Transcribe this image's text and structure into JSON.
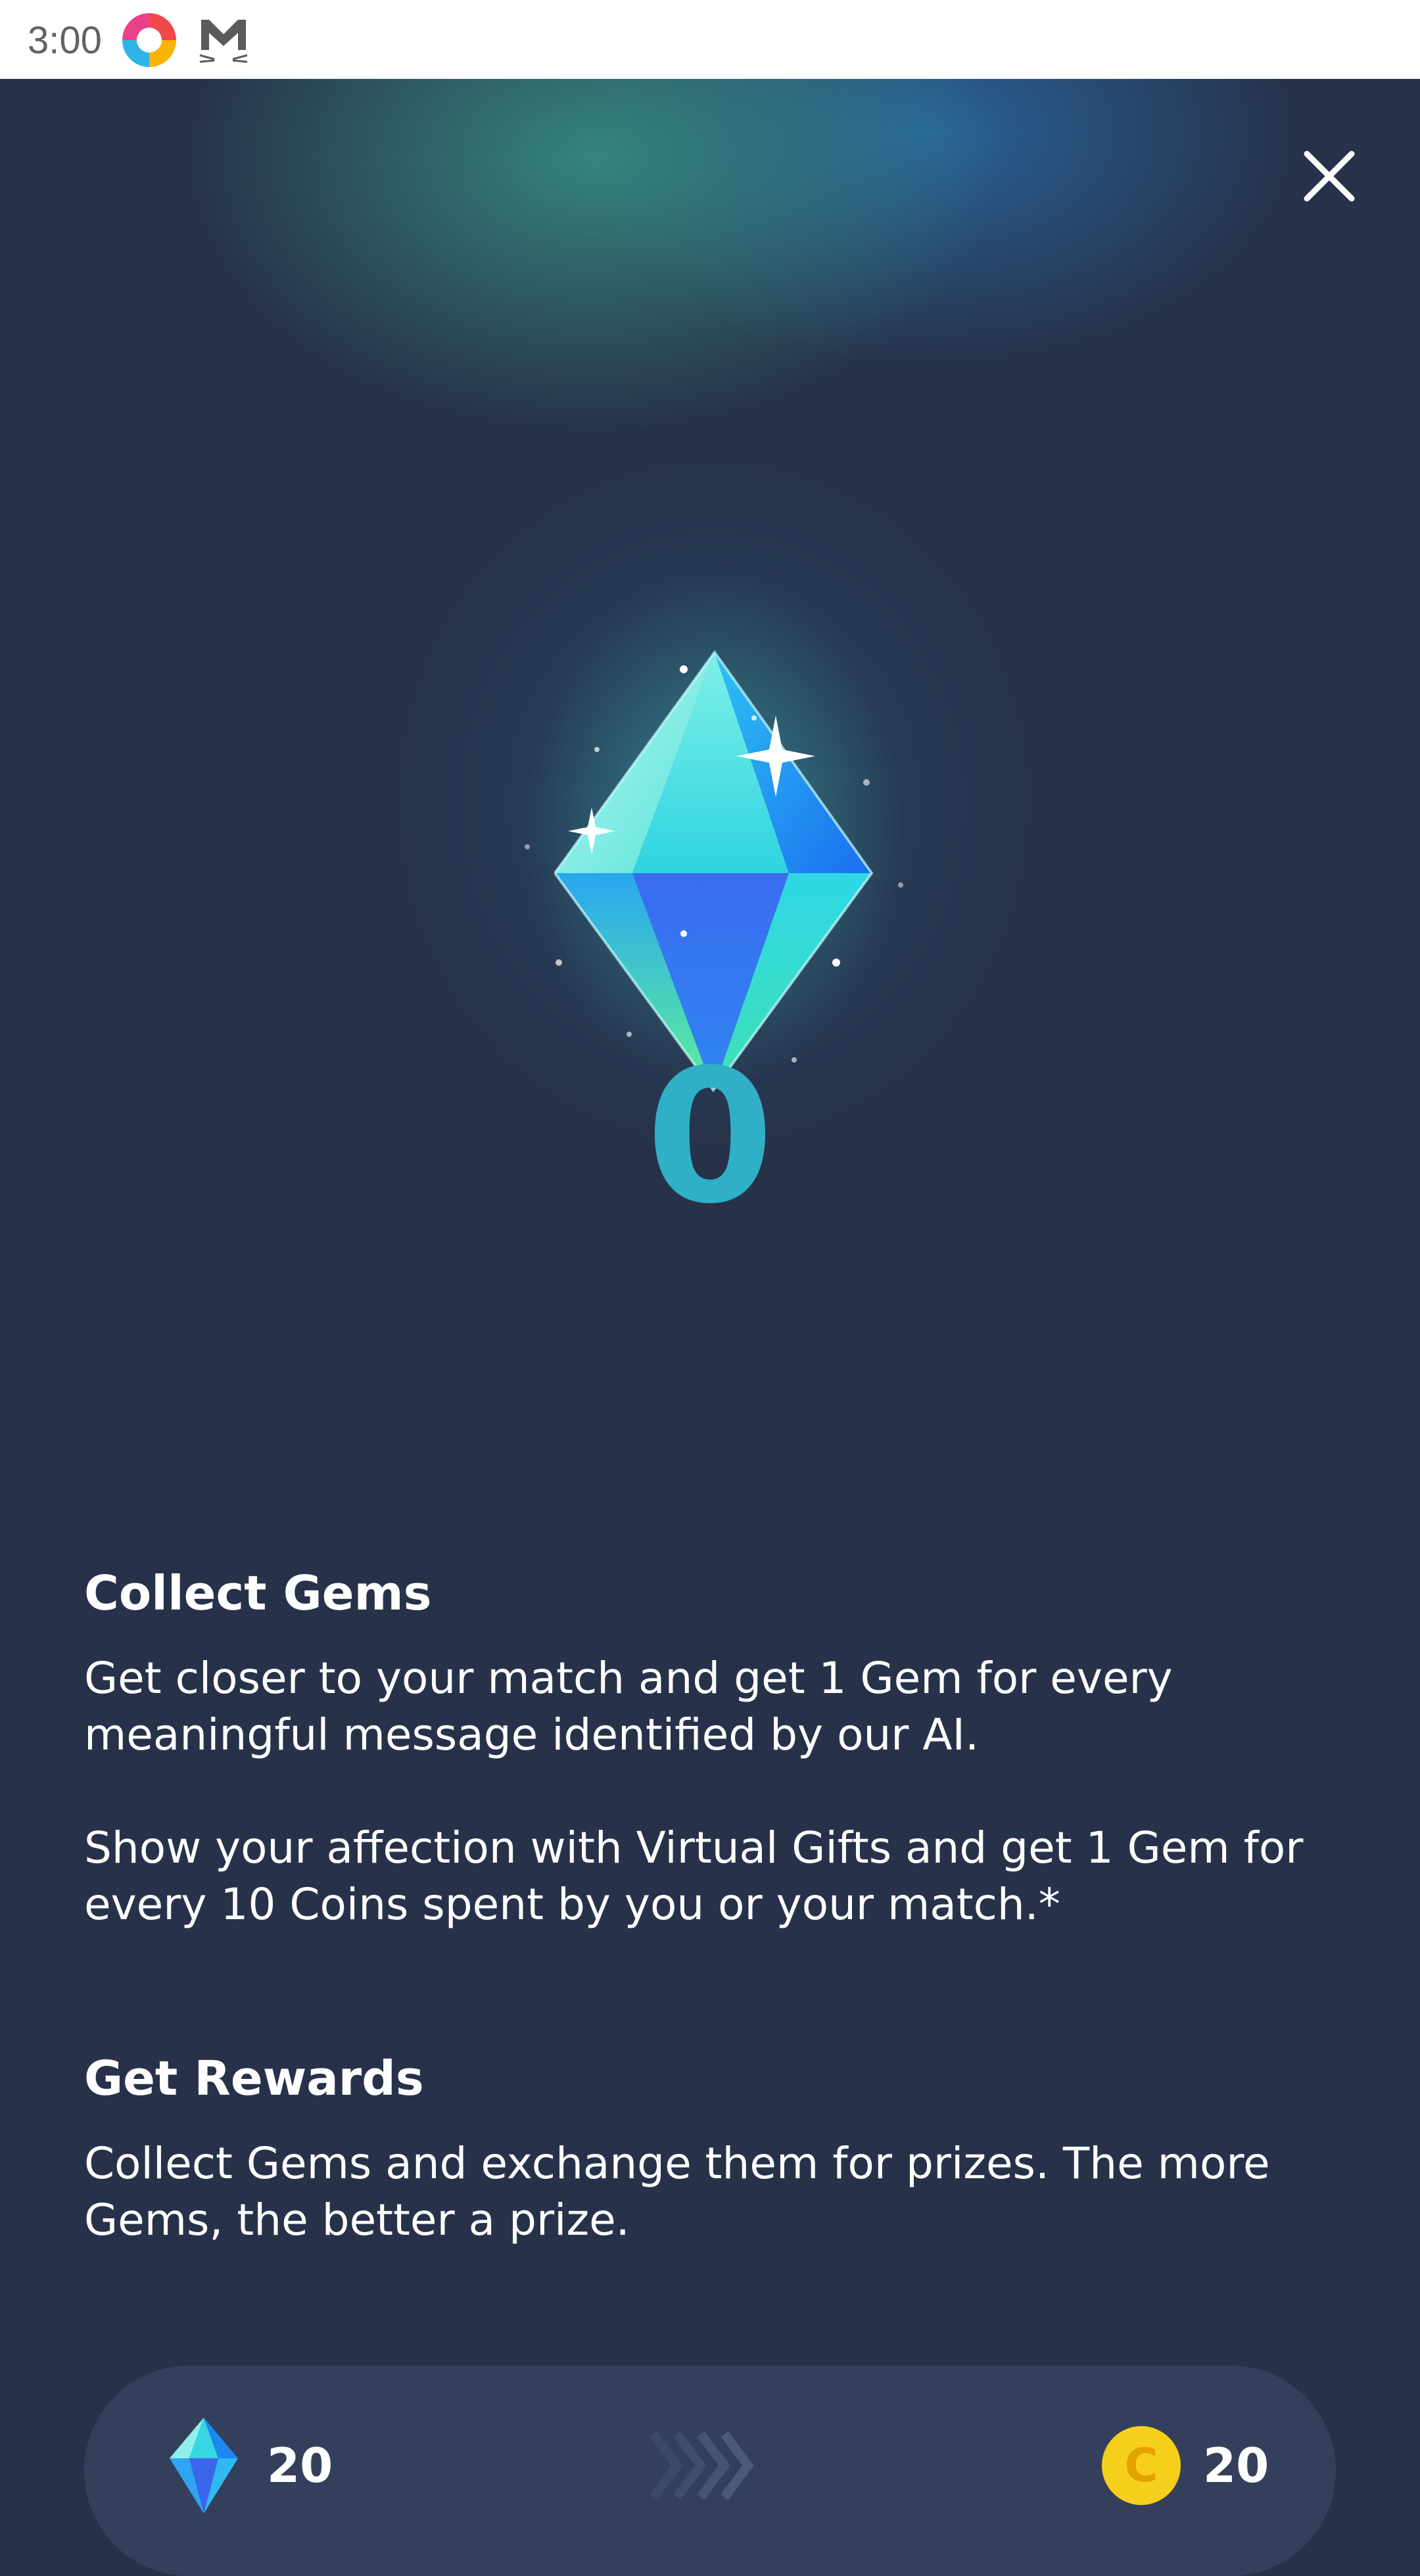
{
  "status_bar": {
    "time": "3:00",
    "icons": [
      "app-notification-icon",
      "mail-icon"
    ]
  },
  "header": {
    "close_icon": "close-icon"
  },
  "gem_balance": {
    "icon": "gem-icon",
    "count": "0"
  },
  "collect_gems": {
    "title": "Collect Gems",
    "paragraph_1": "Get closer to your match and get 1 Gem for every meaningful message identified by our AI.",
    "paragraph_2": "Show your affection with Virtual Gifts and get 1 Gem for every 10 Coins spent by you or your match.*"
  },
  "get_rewards": {
    "title": "Get Rewards",
    "paragraph": "Collect Gems and exchange them for prizes. The more Gems, the better a prize."
  },
  "exchange": {
    "gem_icon": "gem-icon",
    "gems": "20",
    "arrow_icon": "chevrons-right-icon",
    "coin_icon": "coin-icon",
    "coin_symbol": "C",
    "coins": "20"
  },
  "colors": {
    "background": "#27324a",
    "gem_count": "#2fb0c6",
    "coin": "#f6cf1c"
  }
}
